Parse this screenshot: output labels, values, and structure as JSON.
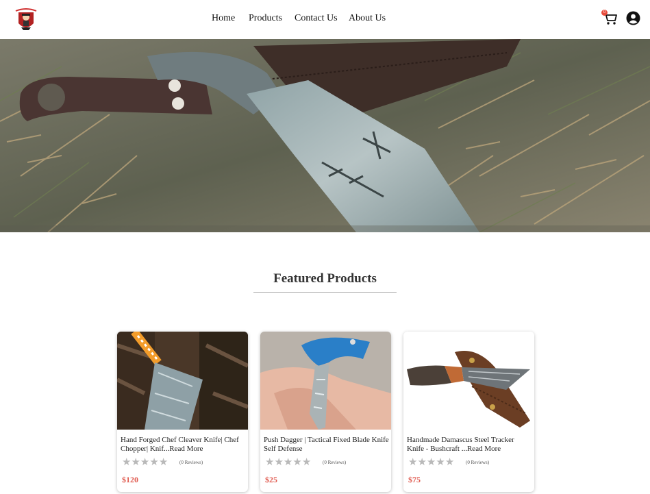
{
  "brand": {
    "logo_icon": "brand-logo-icon"
  },
  "nav": {
    "items": [
      {
        "label": "Home"
      },
      {
        "label": "Products"
      },
      {
        "label": "Contact Us"
      },
      {
        "label": "About Us"
      }
    ]
  },
  "header": {
    "cart_icon": "cart-icon",
    "cart_count": "0",
    "user_icon": "user-circle-icon"
  },
  "hero": {
    "image": "hero-knife-banner"
  },
  "featured": {
    "title": "Featured Products",
    "products": [
      {
        "name": "Hand Forged Chef Cleaver Knife| Chef Chopper| Knif...Read More",
        "reviews": "(0 Reviews)",
        "price": "$120",
        "rating": 0
      },
      {
        "name": "Push Dagger | Tactical Fixed Blade Knife Self Defense",
        "reviews": "(0 Reviews)",
        "price": "$25",
        "rating": 0
      },
      {
        "name": "Handmade Damascus Steel Tracker Knife - Bushcraft ...Read More",
        "reviews": "(0 Reviews)",
        "price": "$75",
        "rating": 0
      }
    ]
  },
  "colors": {
    "price": "#e05a4f",
    "star_empty": "#b9b9b9",
    "badge": "#e74c3c"
  }
}
